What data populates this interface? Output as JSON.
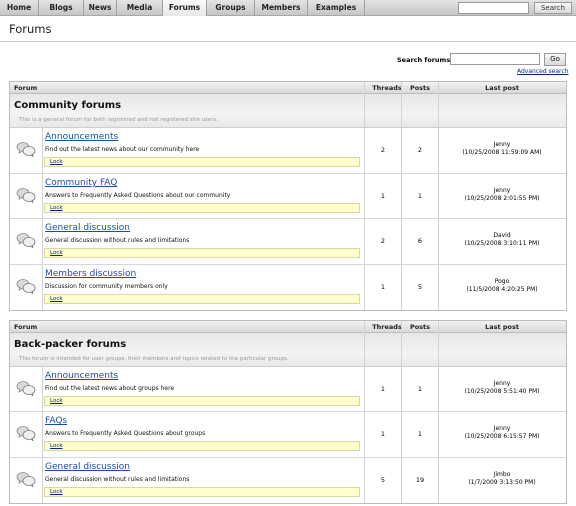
{
  "nav": {
    "tabs": [
      {
        "label": "Home"
      },
      {
        "label": "Blogs"
      },
      {
        "label": "News"
      },
      {
        "label": "Media"
      },
      {
        "label": "Forums"
      },
      {
        "label": "Groups"
      },
      {
        "label": "Members"
      },
      {
        "label": "Examples"
      }
    ],
    "active_tab": "Forums",
    "search_value": "",
    "search_button": "Search"
  },
  "page": {
    "title": "Forums",
    "search_label": "Search forums:",
    "search_value": "",
    "go_button": "Go",
    "advanced_search": "Advanced search"
  },
  "columns": {
    "forum": "Forum",
    "threads": "Threads",
    "posts": "Posts",
    "last_post": "Last post"
  },
  "lock_label": "Lock",
  "groups": [
    {
      "title": "Community forums",
      "description": "This is a general forum for both registered and not registered site users.",
      "forums": [
        {
          "name": "Announcements",
          "description": "Find out the latest news about our community here",
          "threads": "2",
          "posts": "2",
          "last_user": "Jenny",
          "last_date": "(10/25/2008 11:59:09 AM)"
        },
        {
          "name": "Community FAQ",
          "description": "Answers to Frequently Asked Questions about our community",
          "threads": "1",
          "posts": "1",
          "last_user": "Jenny",
          "last_date": "(10/25/2008 2:01:55 PM)"
        },
        {
          "name": "General discussion",
          "description": "General discussion without rules and limitations",
          "threads": "2",
          "posts": "6",
          "last_user": "David",
          "last_date": "(10/25/2008 3:10:11 PM)"
        },
        {
          "name": "Members discussion",
          "description": "Discussion for community members only",
          "threads": "1",
          "posts": "5",
          "last_user": "Pogo",
          "last_date": "(11/5/2008 4:20:25 PM)"
        }
      ]
    },
    {
      "title": "Back-packer forums",
      "description": "This forum is intended for user groups, their members and topics related to the particular groups.",
      "forums": [
        {
          "name": "Announcements",
          "description": "Find out the latest news about groups here",
          "threads": "1",
          "posts": "1",
          "last_user": "Jenny",
          "last_date": "(10/25/2008 5:51:40 PM)"
        },
        {
          "name": "FAQs",
          "description": "Answers to Frequently Asked Questions about groups",
          "threads": "1",
          "posts": "1",
          "last_user": "Jenny",
          "last_date": "(10/25/2008 6:15:57 PM)"
        },
        {
          "name": "General discussion",
          "description": "General discussion without rules and limitations",
          "threads": "5",
          "posts": "19",
          "last_user": "Jimbo",
          "last_date": "(1/7/2009 3:13:50 PM)"
        }
      ]
    }
  ]
}
